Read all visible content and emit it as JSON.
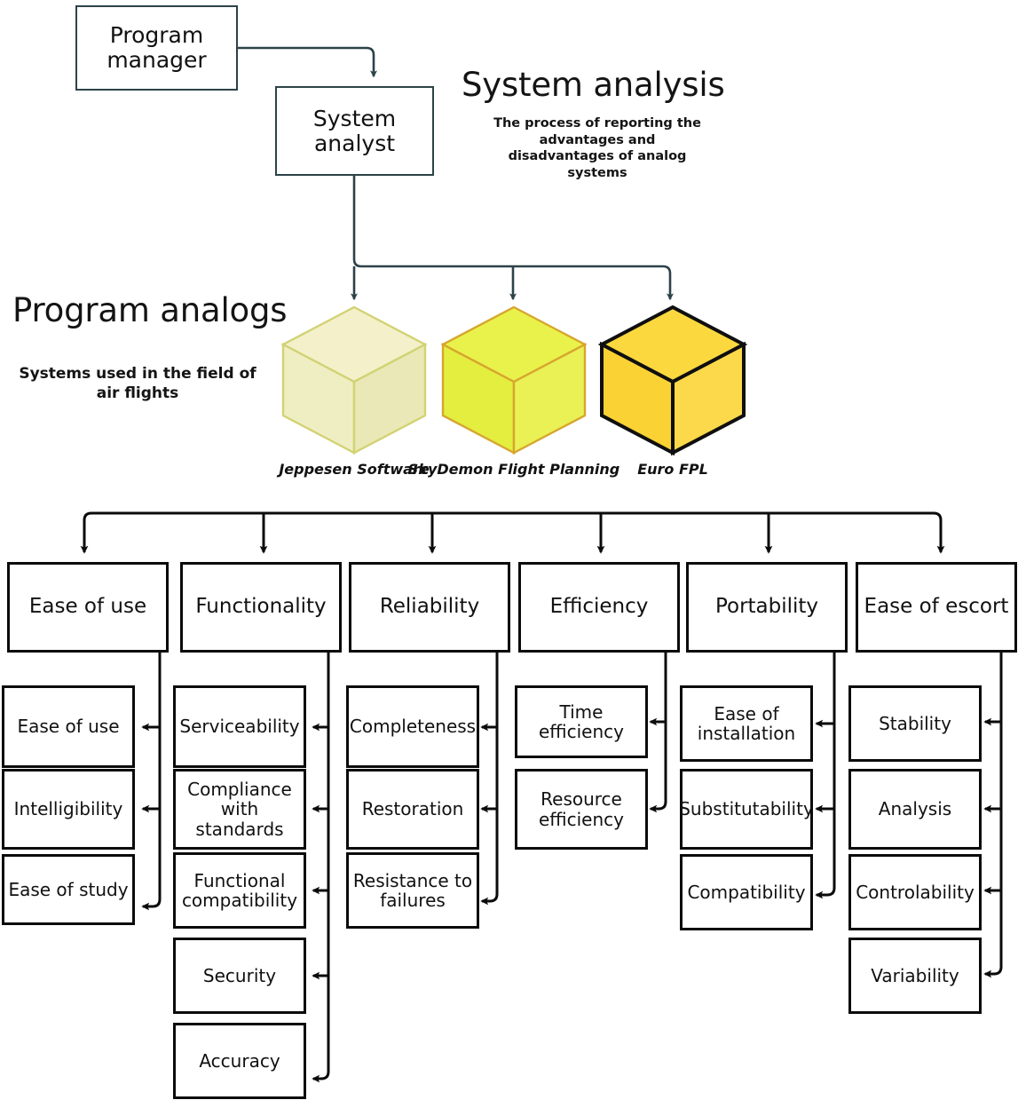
{
  "org": {
    "program_manager": "Program manager",
    "system_analyst": "System analyst"
  },
  "sections": {
    "system_analysis": {
      "title": "System analysis",
      "description": "The process of reporting the advantages and disadvantages of analog systems"
    },
    "program_analogs": {
      "title": "Program analogs",
      "description": "Systems used in the field of air flights"
    }
  },
  "analogs": [
    {
      "label": "Jeppesen Software",
      "face_top": "#f2efc8",
      "face_left": "#efecc0",
      "face_right": "#eae7b5",
      "stroke": "#cfcf6a"
    },
    {
      "label": "SkyDemon Flight Planning",
      "face_top": "#e9f24a",
      "face_left": "#e3ee3f",
      "face_right": "#e8f155",
      "stroke": "#d9a92e"
    },
    {
      "label": "Euro FPL",
      "face_top": "#fcd83f",
      "face_left": "#fbd234",
      "face_right": "#fcd94a",
      "stroke": "#111111"
    }
  ],
  "criteria": [
    {
      "name": "Ease of use",
      "items": [
        "Ease of use",
        "Intelligibility",
        "Ease of study"
      ]
    },
    {
      "name": "Functionality",
      "items": [
        "Serviceability",
        "Compliance with standards",
        "Functional compatibility",
        "Security",
        "Accuracy"
      ]
    },
    {
      "name": "Reliability",
      "items": [
        "Completeness",
        "Restoration",
        "Resistance to failures"
      ]
    },
    {
      "name": "Efficiency",
      "items": [
        "Time efficiency",
        "Resource efficiency"
      ]
    },
    {
      "name": "Portability",
      "items": [
        "Ease of installation",
        "Substitutability",
        "Compatibility"
      ]
    },
    {
      "name": "Ease of escort",
      "items": [
        "Stability",
        "Analysis",
        "Controlability",
        "Variability"
      ]
    }
  ],
  "colors": {
    "org_stroke": "#2c4249",
    "flow_stroke": "#0b0b0b",
    "text": "#111111"
  }
}
